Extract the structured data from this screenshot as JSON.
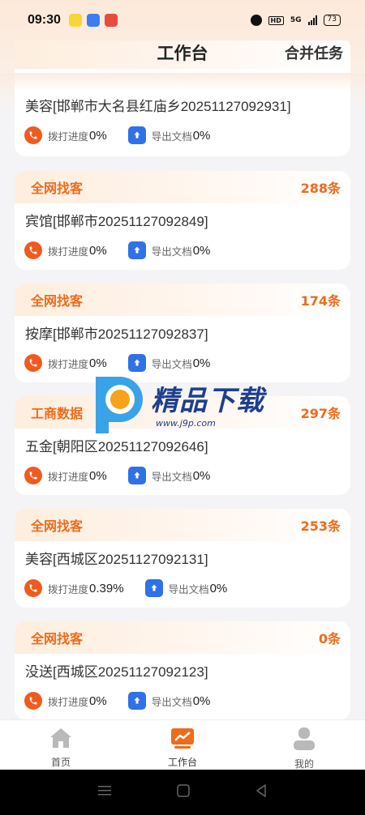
{
  "status_bar": {
    "time": "09:30",
    "hd": "HD",
    "network": "5G",
    "battery": "73"
  },
  "header": {
    "title": "工作台",
    "action": "合并任务"
  },
  "cards": [
    {
      "tag": "",
      "count": "",
      "title": "美容[邯郸市大名县红庙乡20251127092931]",
      "dial_label": "拨打进度",
      "dial_value": "0%",
      "export_label": "导出文档",
      "export_value": "0%"
    },
    {
      "tag": "全网找客",
      "count": "288条",
      "title": "宾馆[邯郸市20251127092849]",
      "dial_label": "拨打进度",
      "dial_value": "0%",
      "export_label": "导出文档",
      "export_value": "0%"
    },
    {
      "tag": "全网找客",
      "count": "174条",
      "title": "按摩[邯郸市20251127092837]",
      "dial_label": "拨打进度",
      "dial_value": "0%",
      "export_label": "导出文档",
      "export_value": "0%"
    },
    {
      "tag": "工商数据",
      "count": "297条",
      "title": "五金[朝阳区20251127092646]",
      "dial_label": "拨打进度",
      "dial_value": "0%",
      "export_label": "导出文档",
      "export_value": "0%"
    },
    {
      "tag": "全网找客",
      "count": "253条",
      "title": "美容[西城区20251127092131]",
      "dial_label": "拨打进度",
      "dial_value": "0.39%",
      "export_label": "导出文档",
      "export_value": "0%"
    },
    {
      "tag": "全网找客",
      "count": "0条",
      "title": "没送[西城区20251127092123]",
      "dial_label": "拨打进度",
      "dial_value": "0%",
      "export_label": "导出文档",
      "export_value": "0%"
    }
  ],
  "watermark": {
    "main": "精品下载",
    "sub": "www.j9p.com"
  },
  "tabbar": {
    "home": "首页",
    "workbench": "工作台",
    "mine": "我的"
  },
  "colors": {
    "accent": "#ee6b1a",
    "phone": "#ef5b1f",
    "export": "#2f71e6"
  }
}
